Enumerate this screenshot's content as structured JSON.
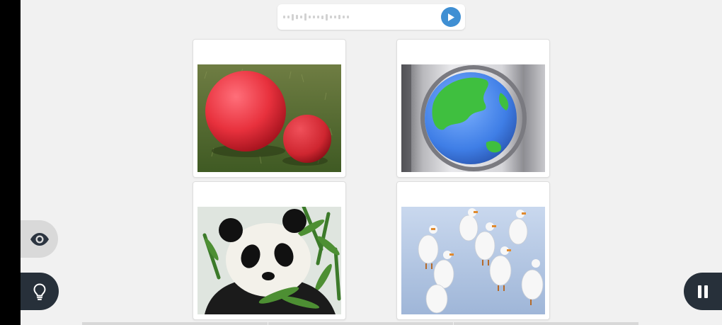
{
  "audio_prompt": {
    "play_icon": "play-icon",
    "play_color": "#3f8fd3"
  },
  "choices": [
    {
      "icon": "red-balls-image"
    },
    {
      "icon": "globe-image"
    },
    {
      "icon": "panda-image"
    },
    {
      "icon": "geese-image"
    }
  ],
  "controls": {
    "reveal_icon": "eye-icon",
    "hint_icon": "lightbulb-icon",
    "pause_icon": "pause-icon",
    "dark_button_color": "#27303a"
  }
}
